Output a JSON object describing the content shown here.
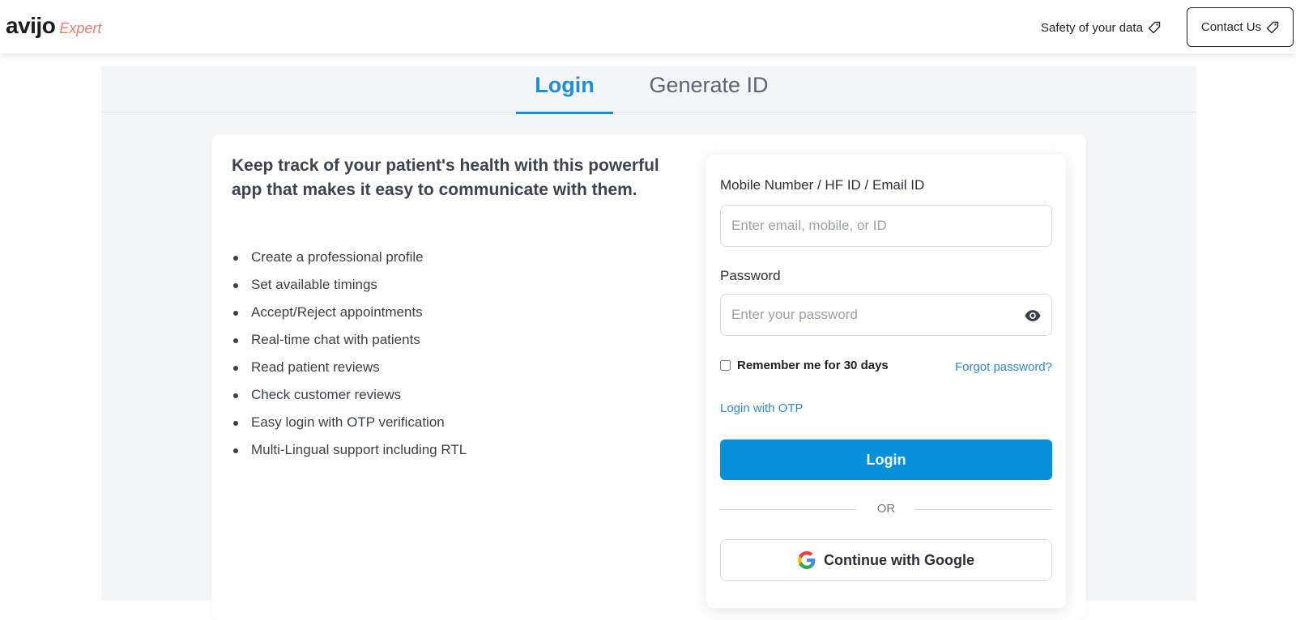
{
  "header": {
    "logo_main": "avijo",
    "logo_sub": "Expert",
    "safety_label": "Safety of your data",
    "contact_label": "Contact Us"
  },
  "tabs": [
    {
      "label": "Login",
      "active": true
    },
    {
      "label": "Generate ID",
      "active": false
    }
  ],
  "intro": {
    "headline": "Keep track of your patient's health with this powerful app that makes it easy to communicate with them.",
    "features": [
      "Create a professional profile",
      "Set available timings",
      "Accept/Reject appointments",
      "Real-time chat with patients",
      "Read patient reviews",
      "Check customer reviews",
      "Easy login with OTP verification",
      "Multi-Lingual support including RTL"
    ]
  },
  "form": {
    "id_label": "Mobile Number / HF ID / Email ID",
    "id_value": "",
    "id_placeholder": "Enter email, mobile, or ID",
    "password_label": "Password",
    "password_value": "",
    "password_placeholder": "Enter your password",
    "remember_label": "Remember me for 30 days",
    "remember_checked": false,
    "forgot_label": "Forgot password?",
    "otp_label": "Login with OTP",
    "login_button": "Login",
    "or_text": "OR",
    "google_button": "Continue with Google"
  },
  "colors": {
    "accent": "#0591d9",
    "link": "#2f8ad4",
    "logo_sub": "#f07a6c",
    "panel_bg": "#f4f5f6"
  },
  "icons": {
    "safety": "tag-icon",
    "contact": "tag-icon",
    "password_toggle": "eye-icon",
    "google": "google-icon"
  }
}
